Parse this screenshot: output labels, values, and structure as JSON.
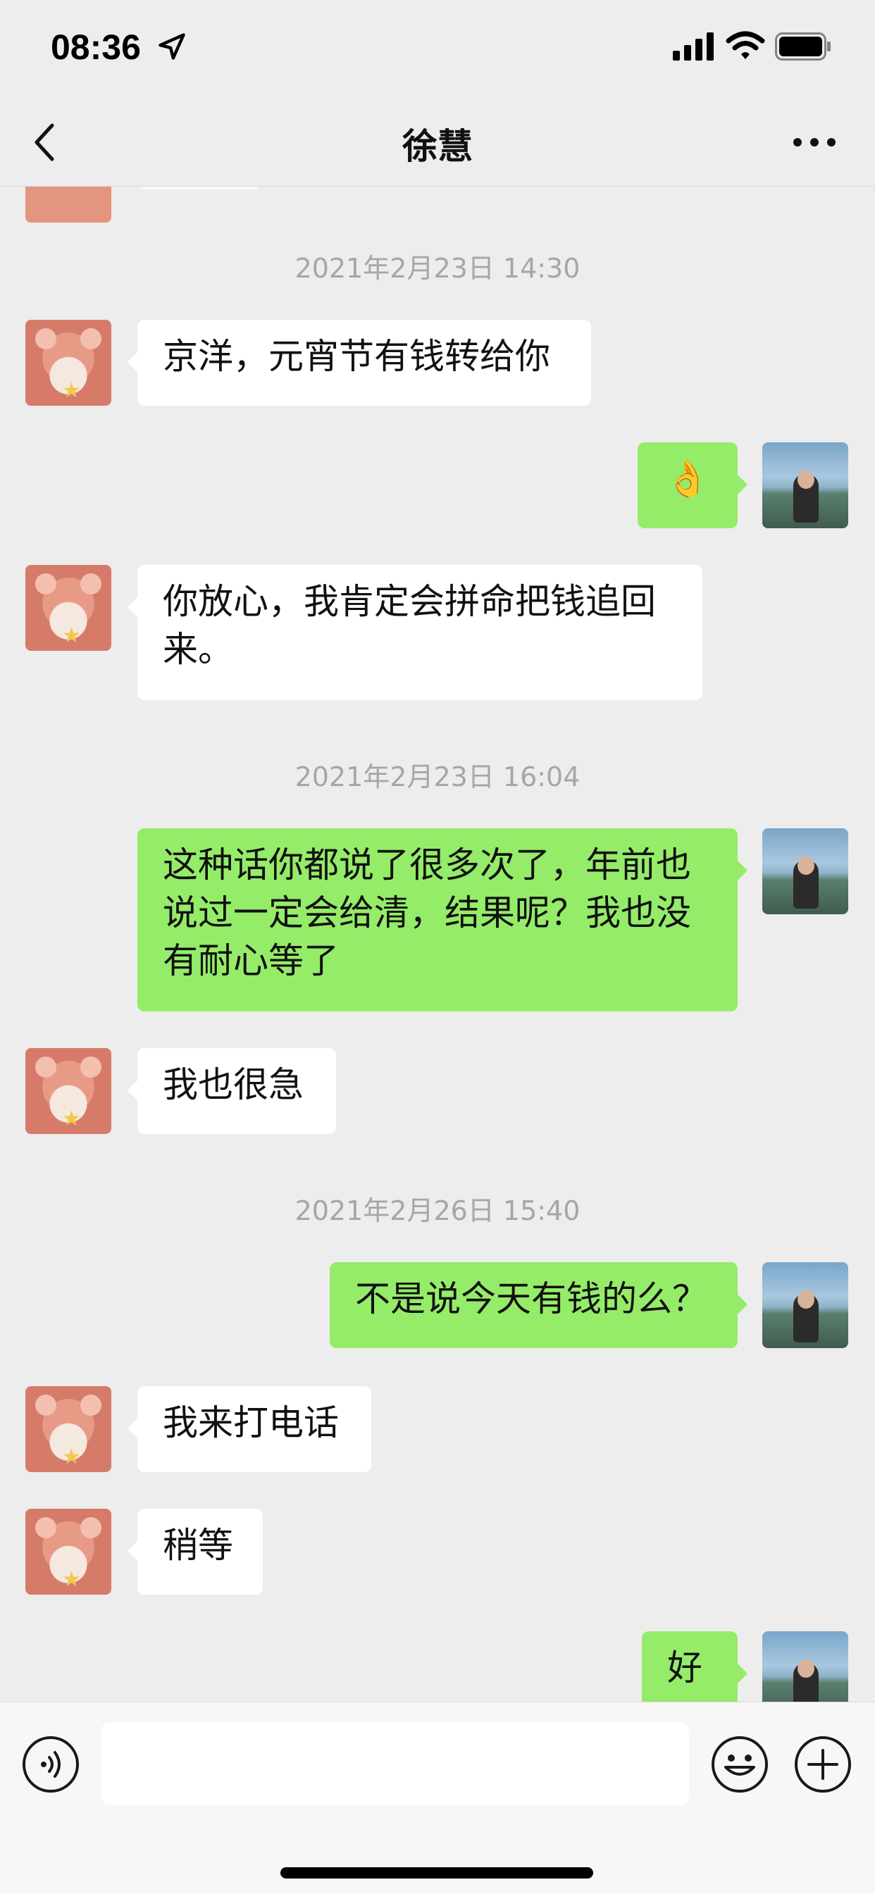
{
  "status": {
    "time": "08:36"
  },
  "nav": {
    "title": "徐慧"
  },
  "messages": [
    {
      "type": "timestamp",
      "text": "2021年2月23日 14:30"
    },
    {
      "type": "in",
      "text": "京洋，元宵节有钱转给你"
    },
    {
      "type": "out",
      "text": "👌"
    },
    {
      "type": "in",
      "line1": "你放心，我肯定会拼命把钱追回",
      "line2": "来。"
    },
    {
      "type": "timestamp",
      "text": "2021年2月23日 16:04"
    },
    {
      "type": "out",
      "line1": "这种话你都说了很多次了，年前也",
      "line2": "说过一定会给清，结果呢？我也没",
      "line3": "有耐心等了"
    },
    {
      "type": "in",
      "text": "我也很急"
    },
    {
      "type": "timestamp",
      "text": "2021年2月26日 15:40"
    },
    {
      "type": "out",
      "text": "不是说今天有钱的么？"
    },
    {
      "type": "in",
      "text": "我来打电话"
    },
    {
      "type": "in",
      "text": "稍等"
    },
    {
      "type": "out",
      "text": "好"
    }
  ],
  "input": {
    "value": ""
  },
  "icons": {
    "back": "chevron-left-icon",
    "more": "ellipsis-icon",
    "voice": "voice-icon",
    "emoji": "emoji-icon",
    "plus": "plus-icon"
  },
  "colors": {
    "background": "#ededed",
    "outgoing_bubble": "#95ec69",
    "incoming_bubble": "#ffffff",
    "timestamp": "#a6a6a6"
  }
}
